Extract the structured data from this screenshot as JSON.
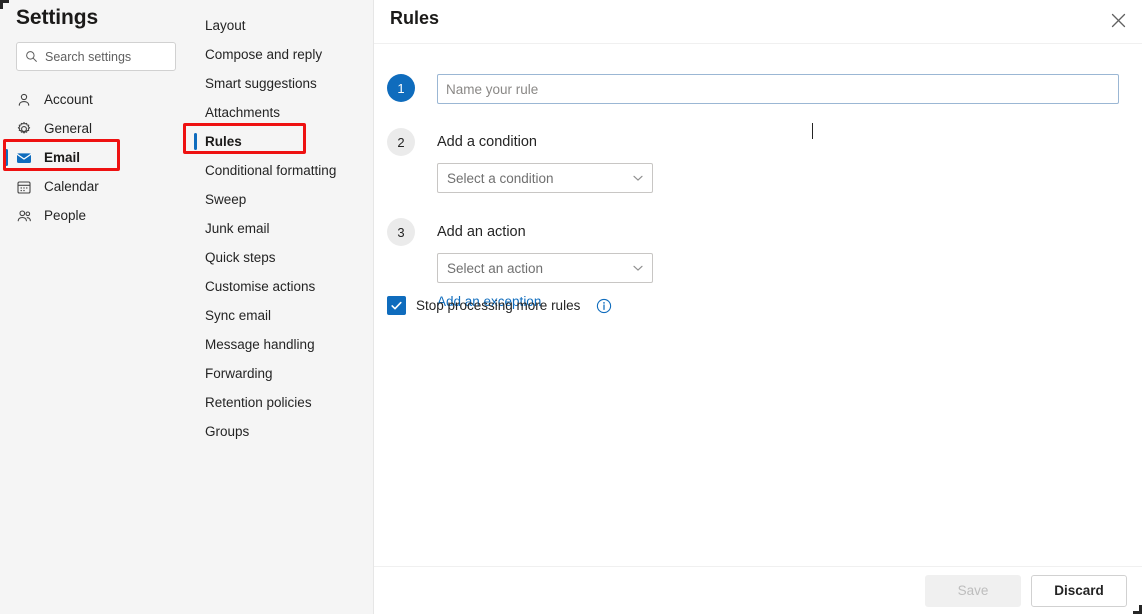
{
  "window": {
    "corner_marks": true
  },
  "sidebar": {
    "title": "Settings",
    "search": {
      "placeholder": "Search settings",
      "value": "",
      "icon": "search-icon"
    },
    "items": [
      {
        "label": "Account",
        "icon": "person-icon",
        "selected": false
      },
      {
        "label": "General",
        "icon": "gear-icon",
        "selected": false
      },
      {
        "label": "Email",
        "icon": "envelope-icon",
        "selected": true
      },
      {
        "label": "Calendar",
        "icon": "calendar-icon",
        "selected": false
      },
      {
        "label": "People",
        "icon": "people-icon",
        "selected": false
      }
    ]
  },
  "subnav": {
    "items": [
      {
        "label": "Layout",
        "selected": false
      },
      {
        "label": "Compose and reply",
        "selected": false
      },
      {
        "label": "Smart suggestions",
        "selected": false
      },
      {
        "label": "Attachments",
        "selected": false
      },
      {
        "label": "Rules",
        "selected": true
      },
      {
        "label": "Conditional formatting",
        "selected": false
      },
      {
        "label": "Sweep",
        "selected": false
      },
      {
        "label": "Junk email",
        "selected": false
      },
      {
        "label": "Quick steps",
        "selected": false
      },
      {
        "label": "Customise actions",
        "selected": false
      },
      {
        "label": "Sync email",
        "selected": false
      },
      {
        "label": "Message handling",
        "selected": false
      },
      {
        "label": "Forwarding",
        "selected": false
      },
      {
        "label": "Retention policies",
        "selected": false
      },
      {
        "label": "Groups",
        "selected": false
      }
    ]
  },
  "panel": {
    "title": "Rules",
    "close_icon": "close-icon",
    "steps": {
      "one": {
        "number": "1",
        "input_placeholder": "Name your rule",
        "input_value": ""
      },
      "two": {
        "number": "2",
        "label": "Add a condition",
        "dropdown_text": "Select a condition",
        "dropdown_icon": "chevron-down-icon"
      },
      "three": {
        "number": "3",
        "label": "Add an action",
        "dropdown_text": "Select an action",
        "dropdown_icon": "chevron-down-icon",
        "exception_link": "Add an exception"
      }
    },
    "stop_processing": {
      "label": "Stop processing more rules",
      "checked": true,
      "info_icon": "info-icon"
    },
    "footer": {
      "save_label": "Save",
      "save_disabled": true,
      "discard_label": "Discard"
    }
  },
  "annotations": {
    "accent_color": "#0f6cbd",
    "highlight_color": "#ee1111",
    "boxes": [
      {
        "target": "sidebar-item-email"
      },
      {
        "target": "subnav-item-rules"
      }
    ]
  }
}
